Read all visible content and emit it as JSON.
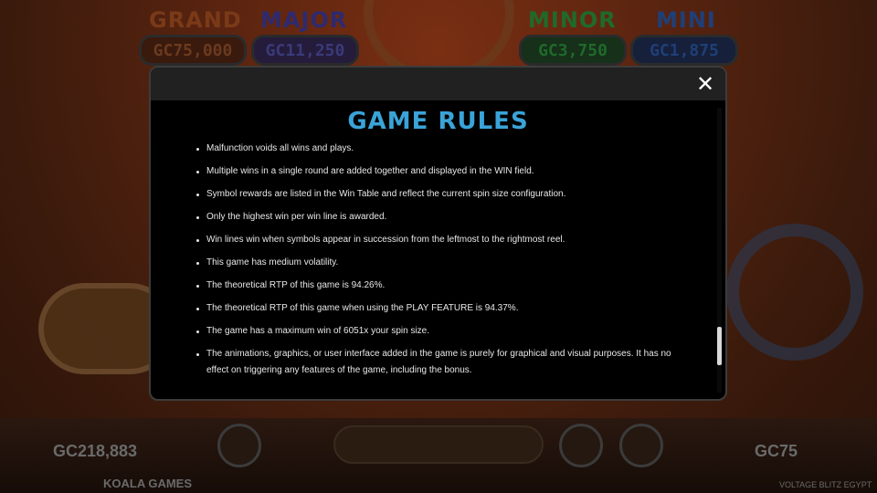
{
  "jackpots": [
    {
      "title": "GRAND",
      "value": "GC75,000",
      "title_color": "#7a3a18",
      "value_color": "#5a2a14"
    },
    {
      "title": "MAJOR",
      "value": "GC11,250",
      "title_color": "#2e2a70",
      "value_color": "#2a2a6a"
    },
    {
      "title": "MINOR",
      "value": "GC3,750",
      "title_color": "#1f6a2a",
      "value_color": "#1d5a24"
    },
    {
      "title": "MINI",
      "value": "GC1,875",
      "title_color": "#1f3f78",
      "value_color": "#1c3570"
    }
  ],
  "bottom": {
    "balance": "GC218,883",
    "bet": "GC75",
    "studio": "KOALA GAMES",
    "game_name": "VOLTAGE BLITZ EGYPT"
  },
  "modal": {
    "title": "GAME RULES",
    "close_glyph": "✕",
    "rules": [
      "Malfunction voids all wins and plays.",
      "Multiple wins in a single round are added together and displayed in the WIN field.",
      "Symbol rewards are listed in the Win Table and reflect the current spin size configuration.",
      "Only the highest win per win line is awarded.",
      "Win lines win when symbols appear in succession from the leftmost to the rightmost reel.",
      "This game has medium volatility.",
      "The theoretical RTP of this game is 94.26%.",
      "The theoretical RTP of this game when using the PLAY FEATURE is 94.37%.",
      "The game has a maximum win of 6051x your spin size.",
      "The animations, graphics, or user interface added in the game is purely for graphical and visual purposes. It has no effect on triggering any features of the game, including the bonus."
    ]
  },
  "colors": {
    "title_accent": "#3aa3d8",
    "modal_bg": "#000000",
    "header_bg": "#212121"
  }
}
